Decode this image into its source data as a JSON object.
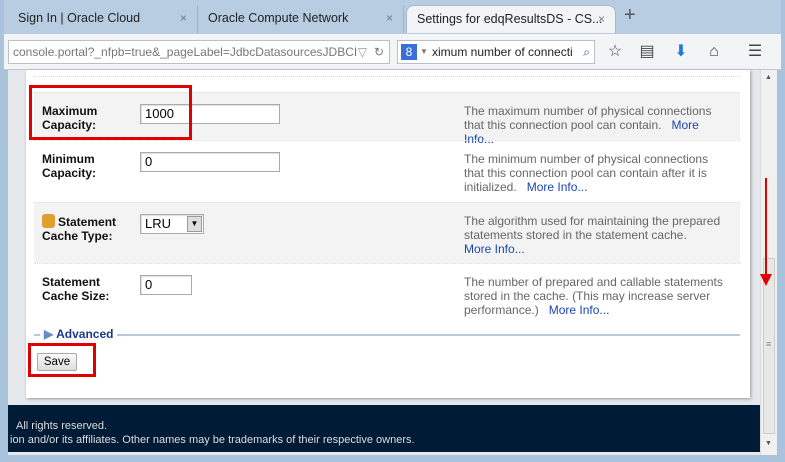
{
  "tabs": [
    {
      "label": "Sign In | Oracle Cloud"
    },
    {
      "label": "Oracle Compute Network"
    },
    {
      "label": "Settings for edqResultsDS - CS...",
      "active": true
    }
  ],
  "tab_close": "×",
  "new_tab": "+",
  "url": "console.portal?_nfpb=true&_pageLabel=JdbcDatasourcesJDBCI",
  "search_value": "ximum number of connecti",
  "fields": [
    {
      "label1": "Maximum",
      "label2": "Capacity:",
      "value": "1000",
      "desc": "The maximum number of physical connections that this connection pool can contain.",
      "more": "More Info..."
    },
    {
      "label1": "Minimum",
      "label2": "Capacity:",
      "value": "0",
      "desc": "The minimum number of physical connections that this connection pool can contain after it is initialized.",
      "more": "More Info..."
    },
    {
      "label1": "Statement",
      "label2": "Cache Type:",
      "value": "LRU",
      "desc": "The algorithm used for maintaining the prepared statements stored in the statement cache.",
      "more": "More Info..."
    },
    {
      "label1": "Statement",
      "label2": "Cache Size:",
      "value": "0",
      "desc": "The number of prepared and callable statements stored in the cache. (This may increase server performance.)",
      "more": "More Info..."
    }
  ],
  "advanced": "Advanced",
  "save": "Save",
  "footer": {
    "line1": "All rights reserved.",
    "line2": "ion and/or its affiliates. Other names may be trademarks of their respective owners."
  },
  "colors": {
    "annotation": "#e00000",
    "footer": "#001b36",
    "link": "#1a46b0"
  }
}
